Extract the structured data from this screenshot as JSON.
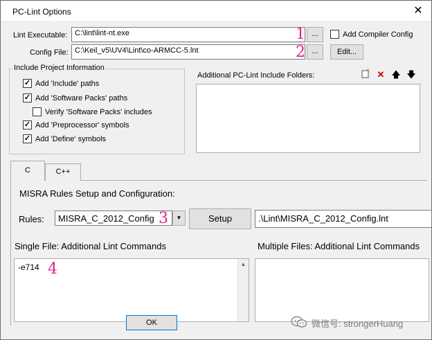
{
  "window": {
    "title": "PC-Lint Options",
    "close_glyph": "✕"
  },
  "lint_exe": {
    "label": "Lint Executable:",
    "value": "C:\\lint\\lint-nt.exe",
    "browse": "...",
    "annotation": "1"
  },
  "add_compiler_config": {
    "label": "Add Compiler Config",
    "checked": false
  },
  "config_file": {
    "label": "Config File:",
    "value": "C:\\Keil_v5\\UV4\\Lint\\co-ARMCC-5.lnt",
    "browse": "...",
    "annotation": "2",
    "edit_label": "Edit..."
  },
  "include_info": {
    "legend": "Include Project Information",
    "items": [
      {
        "label": "Add 'Include' paths",
        "checked": true
      },
      {
        "label": "Add 'Software Packs' paths",
        "checked": true
      },
      {
        "label": "Verify 'Software Packs' includes",
        "checked": false
      },
      {
        "label": "Add 'Preprocessor' symbols",
        "checked": true
      },
      {
        "label": "Add 'Define' symbols",
        "checked": true
      }
    ]
  },
  "include_folders": {
    "label": "Additional PC-Lint Include Folders:"
  },
  "tabs": [
    {
      "label": "C",
      "active": true
    },
    {
      "label": "C++",
      "active": false
    }
  ],
  "misra": {
    "heading": "MISRA Rules Setup and Configuration:",
    "rules_label": "Rules:",
    "rules_value": "MISRA_C_2012_Config",
    "annotation": "3",
    "setup_label": "Setup",
    "path_value": ".\\Lint\\MISRA_C_2012_Config.lnt"
  },
  "single_file": {
    "label": "Single File: Additional Lint Commands",
    "value": "-e714",
    "annotation": "4"
  },
  "multiple_files": {
    "label": "Multiple Files: Additional Lint Commands",
    "value": ""
  },
  "ok_label": "OK",
  "watermark": "微信号: strongerHuang"
}
